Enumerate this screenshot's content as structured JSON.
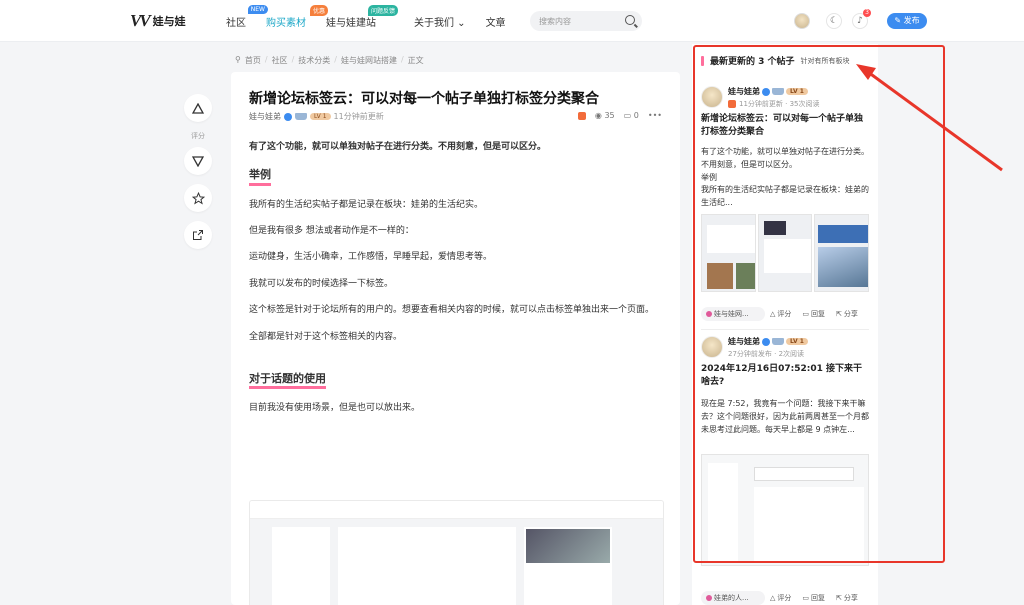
{
  "header": {
    "logo_text": "娃与娃",
    "nav": [
      {
        "label": "社区",
        "badge": "NEW",
        "badge_color": "#3c8cf0"
      },
      {
        "label": "购买素材",
        "badge": "优惠",
        "badge_color": "#f57f3c"
      },
      {
        "label": "娃与娃建站",
        "badge": "问题反馈",
        "badge_color": "#2cb4a0"
      },
      {
        "label": "关于我们 ⌄",
        "badge": "",
        "badge_color": ""
      },
      {
        "label": "文章",
        "badge": "",
        "badge_color": ""
      }
    ],
    "search_placeholder": "搜索内容",
    "notification_count": "3",
    "publish_label": "发布",
    "accent": "#3c8cf0"
  },
  "breadcrumb": [
    "首页",
    "社区",
    "技术分类",
    "娃与娃网站搭建",
    "正文"
  ],
  "leftbar": {
    "vote_label": "评分"
  },
  "article": {
    "title": "新增论坛标签云：可以对每一个帖子单独打标签分类聚合",
    "author": "娃与娃弟",
    "level": "LV 1",
    "time": "11分钟前更新",
    "views": "35",
    "comments": "0",
    "lead": "有了这个功能，就可以单独对帖子在进行分类。不用刻意，但是可以区分。",
    "h_example": "举例",
    "p1": "我所有的生活纪实帖子都是记录在板块：娃弟的生活纪实。",
    "p2": "但是我有很多 想法或者动作是不一样的：",
    "p3": "运动健身，生活小确幸，工作感悟，早睡早起，爱情思考等。",
    "p4": "我就可以发布的时候选择一下标签。",
    "p5": "这个标签是针对于论坛所有的用户的。想要查看相关内容的时候，就可以点击标签单独出来一个页面。",
    "p6": "全部都是针对于这个标签相关的内容。",
    "h_topic": "对于话题的使用",
    "p7": "目前我没有使用场景，但是也可以放出来。"
  },
  "sidebar": {
    "heading": "最新更新的 3 个帖子",
    "subheading": "针对有所有板块",
    "cards": [
      {
        "author": "娃与娃弟",
        "level": "LV 1",
        "meta": "11分钟前更新 · 35次阅读",
        "title": "新增论坛标签云：可以对每一个帖子单独打标签分类聚合",
        "excerpt": "有了这个功能，就可以单独对帖子在进行分类。不用刻意，但是可以区分。\n举例\n我所有的生活纪实帖子都是记录在板块：娃弟的生活纪...",
        "tag": "娃与娃网...",
        "rate": "评分",
        "reply": "回复",
        "share": "分享"
      },
      {
        "author": "娃与娃弟",
        "level": "LV 1",
        "meta": "27分钟前发布 · 2次阅读",
        "title": "2024年12月16日07:52:01 接下来干啥去?",
        "excerpt": "现在是 7:52，我竟有一个问题：我接下来干嘛去？这个问题很好，因为此前两周甚至一个月都未思考过此问题。每天早上都是 9 点钟左...",
        "tag": "娃弟的人...",
        "rate": "评分",
        "reply": "回复",
        "share": "分享"
      }
    ]
  },
  "annotation_color": "#e8362a"
}
